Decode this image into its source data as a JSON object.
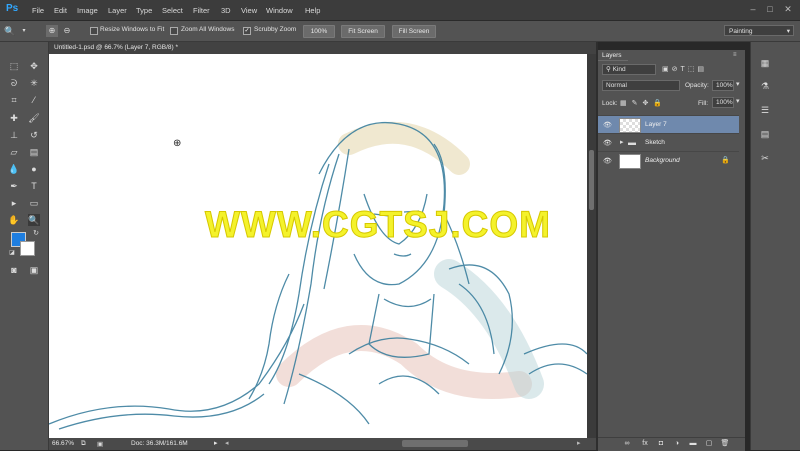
{
  "app": {
    "logo": "Ps"
  },
  "menu": [
    "File",
    "Edit",
    "Image",
    "Layer",
    "Type",
    "Select",
    "Filter",
    "3D",
    "View",
    "Window",
    "Help"
  ],
  "options": {
    "resize_windows": "Resize Windows to Fit",
    "zoom_all": "Zoom All Windows",
    "scrubby_zoom": "Scrubby Zoom",
    "btn_100": "100%",
    "btn_fit": "Fit Screen",
    "btn_fill": "Fill Screen",
    "workspace": "Painting"
  },
  "document": {
    "tab_title": "Untitled-1.psd @ 66.7% (Layer 7, RGB/8) *",
    "zoom": "66.67%",
    "doc_size": "Doc: 36.3M/161.6M"
  },
  "layers_panel": {
    "tab": "Layers",
    "filter": "Kind",
    "blend": "Normal",
    "opacity_label": "Opacity:",
    "opacity": "100%",
    "lock_label": "Lock:",
    "fill_label": "Fill:",
    "fill": "100%",
    "layers": [
      {
        "name": "Layer 7",
        "selected": true
      },
      {
        "name": "Sketch",
        "selected": false
      },
      {
        "name": "Background",
        "selected": false
      }
    ]
  },
  "watermark": "WWW.CGTSJ.COM",
  "colors": {
    "foreground": "#1e7ee0",
    "background": "#ffffff",
    "selected_layer": "#6f89ad",
    "sketch_stroke": "#3b7f9e"
  }
}
